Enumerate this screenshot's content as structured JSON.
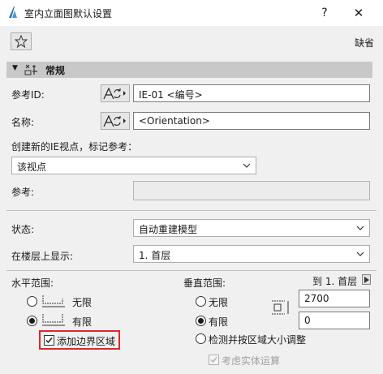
{
  "window": {
    "title": "室内立面图默认设置",
    "help": "?",
    "close": "✕"
  },
  "toolbar": {
    "default_label": "缺省"
  },
  "section": {
    "title": "常规"
  },
  "ref_id": {
    "label": "参考ID:",
    "value": "IE-01 <编号>"
  },
  "name": {
    "label": "名称:",
    "value": "<Orientation>"
  },
  "create_new": {
    "label": "创建新的IE视点，标记参考：",
    "selected": "该视点"
  },
  "reference": {
    "label": "参考:",
    "value": ""
  },
  "status": {
    "label": "状态:",
    "selected": "自动重建模型"
  },
  "show_on_story": {
    "label": "在楼层上显示:",
    "selected": "1. 首层"
  },
  "horizontal": {
    "title": "水平范围:",
    "opt_infinite": "无限",
    "opt_limited": "有限",
    "add_border": "添加边界区域"
  },
  "vertical": {
    "title": "垂直范围:",
    "to_story": "到 1. 首层",
    "opt_infinite": "无限",
    "opt_limited": "有限",
    "opt_detect": "检测并按区域大小调整",
    "top_value": "2700",
    "bottom_value": "0",
    "consider_solid": "考虑实体运算"
  },
  "colors": {
    "highlight": "#e0262b",
    "section_bg": "#c8c8c8"
  }
}
